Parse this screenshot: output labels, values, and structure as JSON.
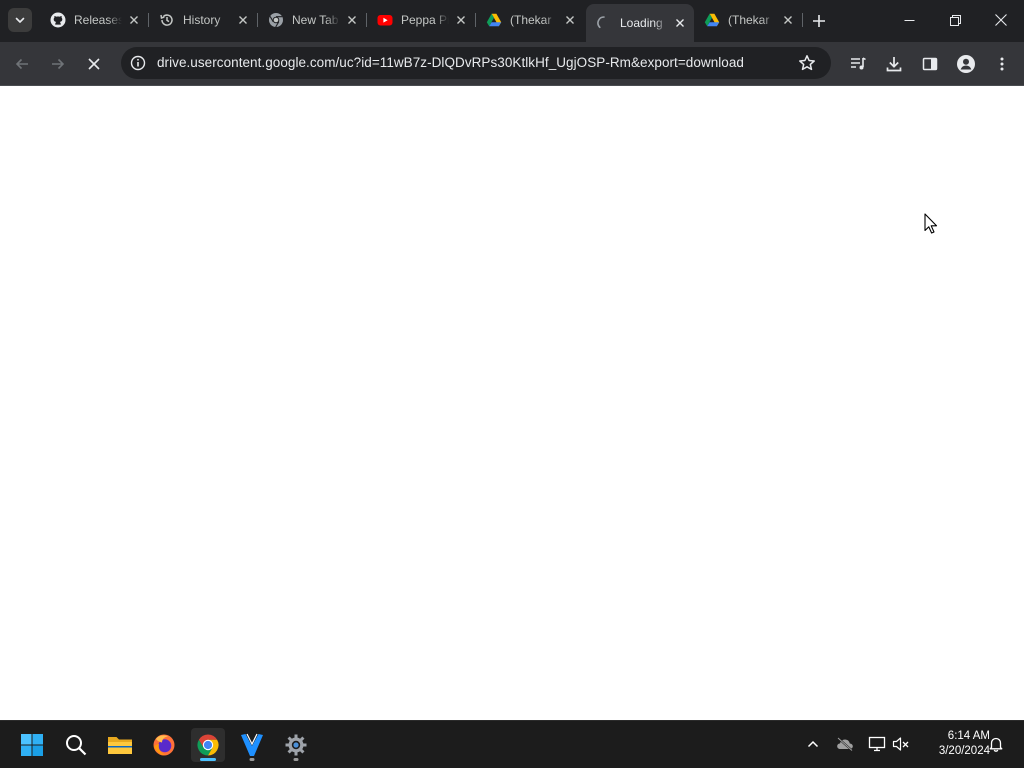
{
  "browser": {
    "tabs": [
      {
        "title": "Releases",
        "icon": "github-icon"
      },
      {
        "title": "History",
        "icon": "history-icon"
      },
      {
        "title": "New Tab",
        "icon": "chrome-icon"
      },
      {
        "title": "Peppa Pig",
        "icon": "youtube-icon"
      },
      {
        "title": "(Thekar",
        "icon": "google-drive-icon"
      },
      {
        "title": "Loading",
        "icon": "loading-spinner-icon",
        "active": true
      },
      {
        "title": "(Thekar",
        "icon": "google-drive-icon"
      }
    ],
    "address_bar": {
      "url": "drive.usercontent.google.com/uc?id=11wB7z-DlQDvRPs30KtlkHf_UgjOSP-Rm&export=download"
    },
    "loading": true
  },
  "taskbar": {
    "apps": [
      "windows-start-icon",
      "search-icon",
      "file-explorer-icon",
      "firefox-icon",
      "chrome-icon",
      "visual-studio-icon",
      "settings-icon"
    ],
    "active_app": "chrome-icon",
    "clock": {
      "time": "6:14 AM",
      "date": "3/20/2024"
    }
  },
  "colors": {
    "tabstrip": "#202124",
    "toolbar": "#35363a",
    "taskbar": "#1c1c1c",
    "accent": "#4cc2ff"
  }
}
